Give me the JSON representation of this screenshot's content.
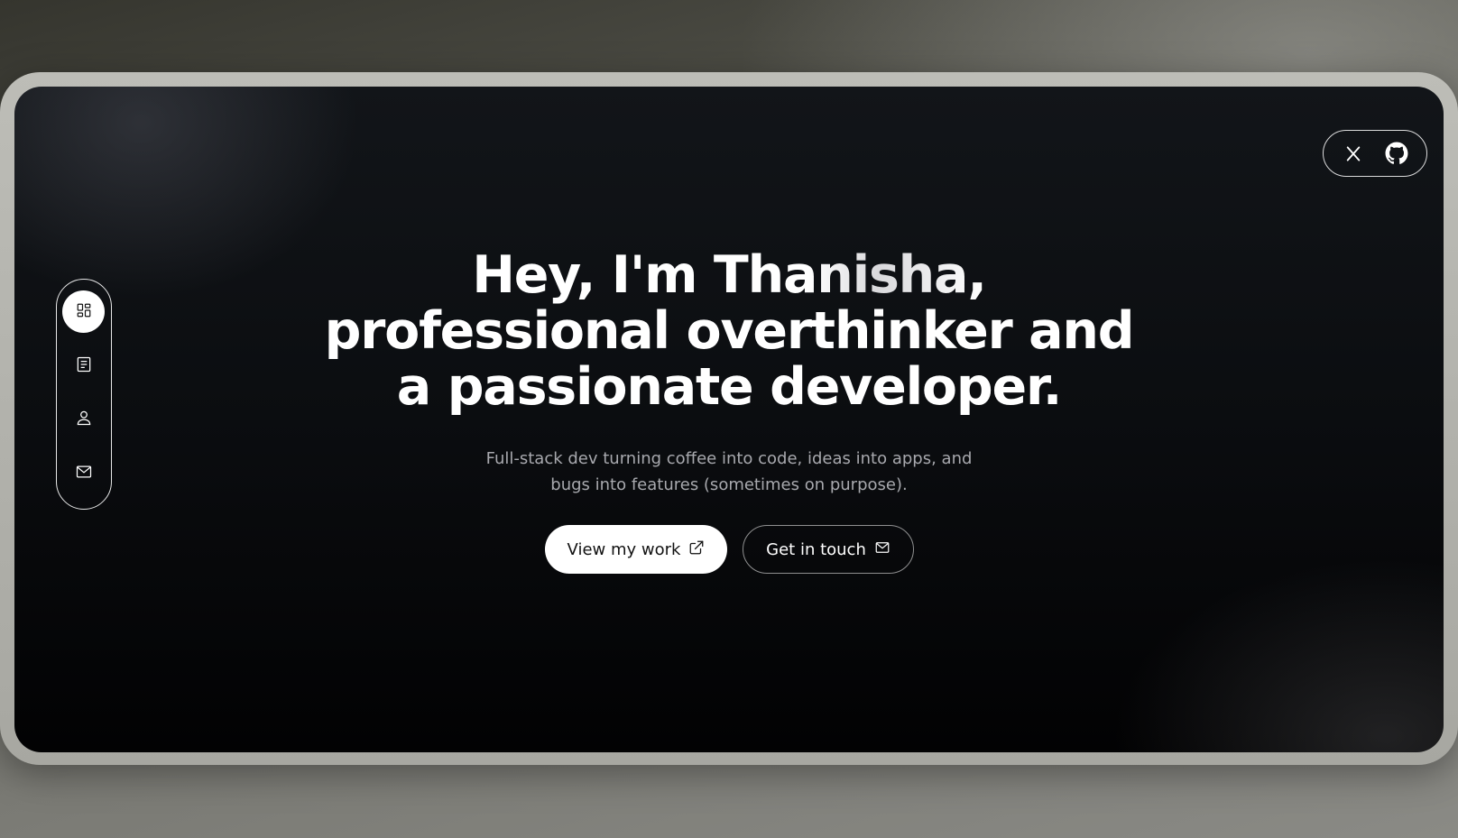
{
  "social": {
    "items": [
      {
        "name": "x-icon",
        "label": "X"
      },
      {
        "name": "github-icon",
        "label": "GitHub"
      }
    ]
  },
  "sidenav": {
    "items": [
      {
        "icon": "dashboard-icon",
        "active": true
      },
      {
        "icon": "document-icon",
        "active": false
      },
      {
        "icon": "user-icon",
        "active": false
      },
      {
        "icon": "mail-icon",
        "active": false
      }
    ]
  },
  "hero": {
    "title_lines": [
      {
        "before": "Hey, I'm ",
        "highlight": "Thanisha,"
      },
      "professional overthinker and",
      "a passionate developer."
    ],
    "subtitle_lines": [
      "Full-stack dev turning coffee into code, ideas into apps, and",
      "bugs into features (sometimes on purpose)."
    ]
  },
  "buttons": {
    "primary_label": "View my work",
    "primary_icon": "external-link-icon",
    "secondary_label": "Get in touch",
    "secondary_icon": "mail-icon"
  },
  "colors": {
    "screen_bg": "#0b0d10",
    "text_primary": "#ffffff",
    "text_muted": "#a8a9ae",
    "frame_bezel": "#b5b5af"
  }
}
